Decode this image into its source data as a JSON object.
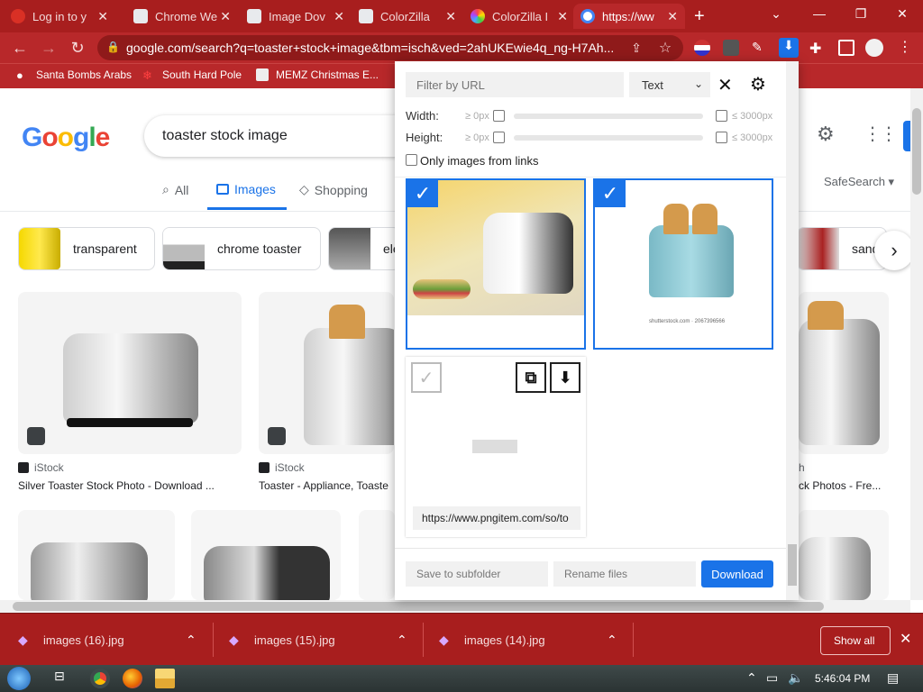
{
  "browser": {
    "tabs": [
      {
        "title": "Log in to y",
        "color": "#d93025"
      },
      {
        "title": "Chrome We",
        "color": "#e8eaed"
      },
      {
        "title": "Image Dov",
        "color": "#e8eaed"
      },
      {
        "title": "ColorZilla",
        "color": "#e8eaed"
      },
      {
        "title": "ColorZilla I",
        "color": "#9b59b6"
      },
      {
        "title": "https://ww",
        "color": "#4285f4"
      }
    ],
    "url": "google.com/search?q=toaster+stock+image&tbm=isch&ved=2ahUKEwie4q_ng-H7Ah...",
    "bookmarks": [
      "Santa Bombs Arabs",
      "South Hard Pole",
      "MEMZ Christmas E..."
    ]
  },
  "google": {
    "logo": "Google",
    "query": "toaster stock image",
    "tabs": [
      "All",
      "Images",
      "Shopping"
    ],
    "safesearch": "SafeSearch",
    "chips": [
      "transparent",
      "chrome toaster",
      "ele",
      "sandwi"
    ],
    "results": [
      {
        "source": "iStock",
        "caption": "Silver Toaster Stock Photo - Download ..."
      },
      {
        "source": "iStock",
        "caption": "Toaster - Appliance, Toaste"
      },
      {
        "source": "h",
        "caption": "ck Photos - Fre..."
      }
    ]
  },
  "popup": {
    "filter_placeholder": "Filter by URL",
    "type_select": "Text",
    "width_label": "Width:",
    "height_label": "Height:",
    "min_label": "≥ 0px",
    "max_label": "≤ 3000px",
    "only_links_label": "Only images from links",
    "third_image_url": "https://www.pngitem.com/so/to",
    "card2_watermark": "shutterstock.com · 2067396566",
    "subfolder_placeholder": "Save to subfolder",
    "rename_placeholder": "Rename files",
    "download_label": "Download"
  },
  "downloads": {
    "items": [
      "images (16).jpg",
      "images (15).jpg",
      "images (14).jpg"
    ],
    "show_all": "Show all"
  },
  "taskbar": {
    "clock": "5:46:04 PM"
  }
}
